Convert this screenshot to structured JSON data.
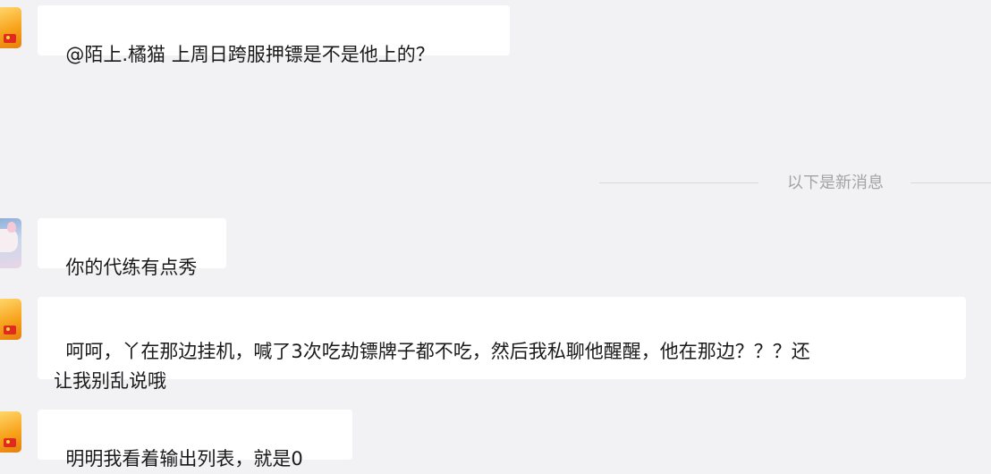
{
  "messages": [
    {
      "id": "m1",
      "text": "@陌上.橘猫 上周日跨服押镖是不是他上的？"
    },
    {
      "id": "m2",
      "text": "你的代练有点秀"
    },
    {
      "id": "m3",
      "text": "呵呵，丫在那边挂机，喊了3次吃劫镖牌子都不吃，然后我私聊他醒醒，他在那边？？？还\n让我别乱说哦"
    },
    {
      "id": "m4",
      "text": "明明我看着输出列表，就是0"
    }
  ],
  "divider": {
    "label": "以下是新消息"
  },
  "avatars": [
    {
      "for": "m1",
      "icon": "user-avatar-orange-icon"
    },
    {
      "for": "m2",
      "icon": "user-avatar-anime-icon"
    },
    {
      "for": "m3",
      "icon": "user-avatar-orange-icon"
    },
    {
      "for": "m4",
      "icon": "user-avatar-orange-icon"
    }
  ],
  "colors": {
    "background": "#f2f2f4",
    "bubble": "#ffffff",
    "divider_text": "#a3a3a8"
  }
}
